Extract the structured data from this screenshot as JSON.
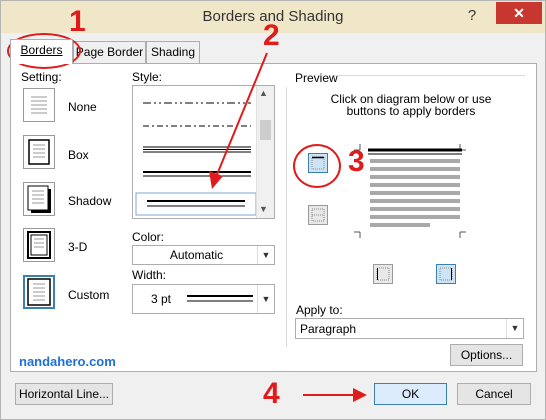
{
  "window": {
    "title": "Borders and Shading",
    "help_glyph": "?",
    "close_glyph": "✕"
  },
  "tabs": [
    {
      "label": "Borders",
      "active": true
    },
    {
      "label": "Page Border",
      "active": false
    },
    {
      "label": "Shading",
      "active": false
    }
  ],
  "setting": {
    "label": "Setting:",
    "options": [
      "None",
      "Box",
      "Shadow",
      "3-D",
      "Custom"
    ],
    "selected": "Custom"
  },
  "style": {
    "label": "Style:",
    "selected_index": 4
  },
  "color": {
    "label": "Color:",
    "value": "Automatic"
  },
  "width": {
    "label": "Width:",
    "value": "3 pt"
  },
  "preview": {
    "label": "Preview",
    "instructions_line1": "Click on diagram below or use",
    "instructions_line2": "buttons to apply borders"
  },
  "apply_to": {
    "label": "Apply to:",
    "value": "Paragraph"
  },
  "buttons": {
    "options": "Options...",
    "horizontal_line": "Horizontal Line...",
    "ok": "OK",
    "cancel": "Cancel"
  },
  "annotations": {
    "step1": "1",
    "step2": "2",
    "step3": "3",
    "step4": "4",
    "color": "#e01b1b"
  },
  "watermark": "nandahero.com"
}
